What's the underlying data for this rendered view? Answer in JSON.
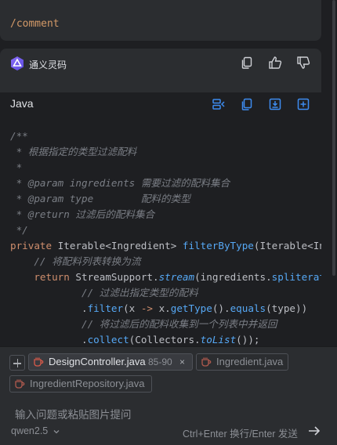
{
  "user_message": {
    "command": "/comment"
  },
  "ai": {
    "brand": "通义灵码",
    "actions": [
      "copy-icon",
      "thumbs-up-icon",
      "thumbs-down-icon"
    ]
  },
  "code_block": {
    "language": "Java",
    "toolbar_icons": [
      "insert-diff-icon",
      "copy-icon",
      "insert-at-cursor-icon",
      "new-file-icon"
    ],
    "lines": [
      "/**",
      " * 根据指定的类型过滤配料",
      " *",
      " * @param ingredients 需要过滤的配料集合",
      " * @param type        配料的类型",
      " * @return 过滤后的配料集合",
      " */",
      "private Iterable<Ingredient> filterByType(Iterable<Ingredient> ingredients, Type type) {",
      "    // 将配料列表转换为流",
      "    return StreamSupport.stream(ingredients.spliterator(), false)",
      "            // 过滤出指定类型的配料",
      "            .filter(x -> x.getType().equals(type))",
      "            // 将过滤后的配料收集到一个列表中并返回",
      "            .collect(Collectors.toList());"
    ]
  },
  "context_files": [
    {
      "name": "DesignController.java",
      "range": "85-90",
      "close": "×",
      "active": true
    },
    {
      "name": "Ingredient.java",
      "active": false
    },
    {
      "name": "IngredientRepository.java",
      "active": false
    }
  ],
  "input": {
    "placeholder": "输入问题或粘贴图片提问",
    "model": "qwen2.5",
    "hint": "Ctrl+Enter 换行/Enter 发送"
  },
  "colors": {
    "background": "#1e1f22",
    "panel": "#2b2d30",
    "keyword": "#cf8e6d",
    "function": "#56a8f5",
    "comment": "#7a7e85",
    "command": "#d49a68",
    "accent": "#3d8cf0"
  }
}
